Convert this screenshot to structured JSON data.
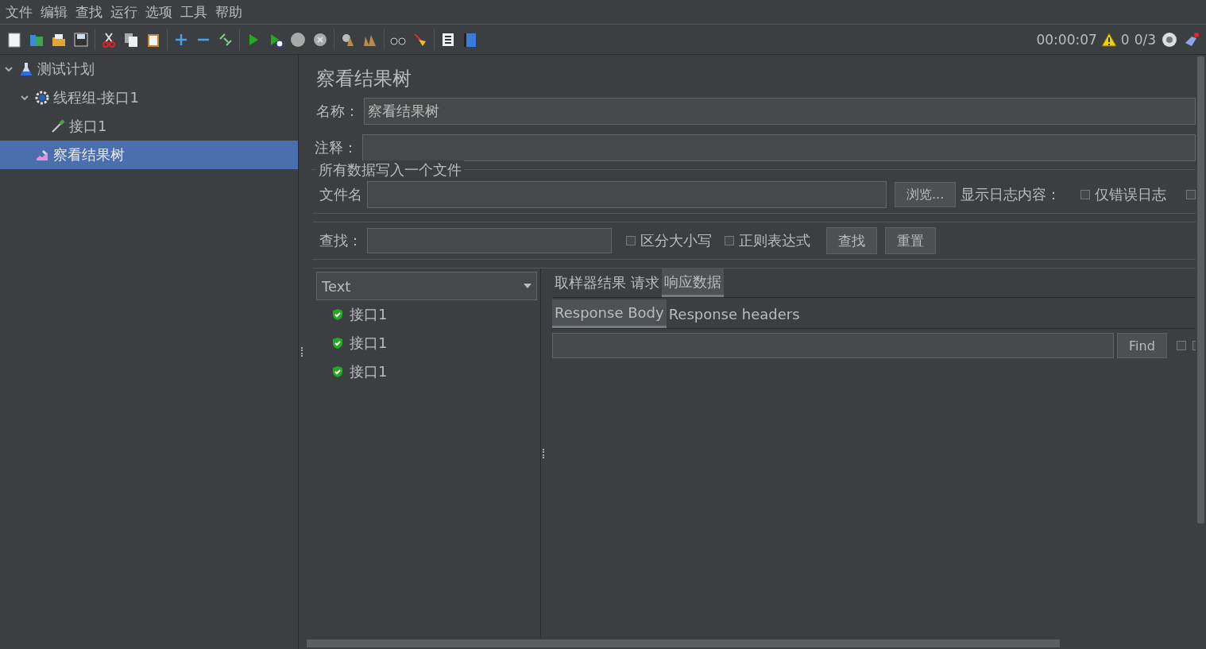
{
  "menu": [
    "文件",
    "编辑",
    "查找",
    "运行",
    "选项",
    "工具",
    "帮助"
  ],
  "status": {
    "timer": "00:00:07",
    "warnings": "0",
    "threads": "0/3"
  },
  "tree": [
    {
      "label": "测试计划",
      "kind": "plan",
      "expanded": true,
      "selected": false,
      "children": [
        {
          "label": "线程组-接口1",
          "kind": "thread-group",
          "expanded": true,
          "selected": false,
          "children": [
            {
              "label": "接口1",
              "kind": "sampler",
              "selected": false
            }
          ]
        },
        {
          "label": "察看结果树",
          "kind": "listener",
          "selected": true
        }
      ]
    }
  ],
  "panel": {
    "title": "察看结果树",
    "name_label": "名称：",
    "name_value": "察看结果树",
    "comment_label": "注释：",
    "file_section": "所有数据写入一个文件",
    "file_label": "文件名",
    "browse_button": "浏览...",
    "log_label": "显示日志内容：",
    "log_options": [
      {
        "label": "仅错误日志",
        "checked": false
      },
      {
        "checked": false
      }
    ],
    "search_label": "查找：",
    "search_options": [
      {
        "label": "区分大小写",
        "checked": false
      },
      {
        "label": "正则表达式",
        "checked": false
      }
    ],
    "search_buttons": [
      "查找",
      "重置"
    ],
    "renderer": "Text",
    "results": [
      {
        "label": "接口1",
        "kind": "success"
      },
      {
        "label": "接口1",
        "kind": "success"
      },
      {
        "label": "接口1",
        "kind": "success"
      }
    ],
    "tabs": [
      {
        "label": "取样器结果",
        "selected": false
      },
      {
        "label": "请求",
        "selected": false
      },
      {
        "label": "响应数据",
        "selected": true
      }
    ],
    "subtabs": [
      {
        "label": "Response Body",
        "selected": true
      },
      {
        "label": "Response headers",
        "selected": false
      }
    ],
    "find_button": "Find",
    "find_options": [
      {
        "checked": false
      },
      {
        "checked": false
      }
    ]
  }
}
